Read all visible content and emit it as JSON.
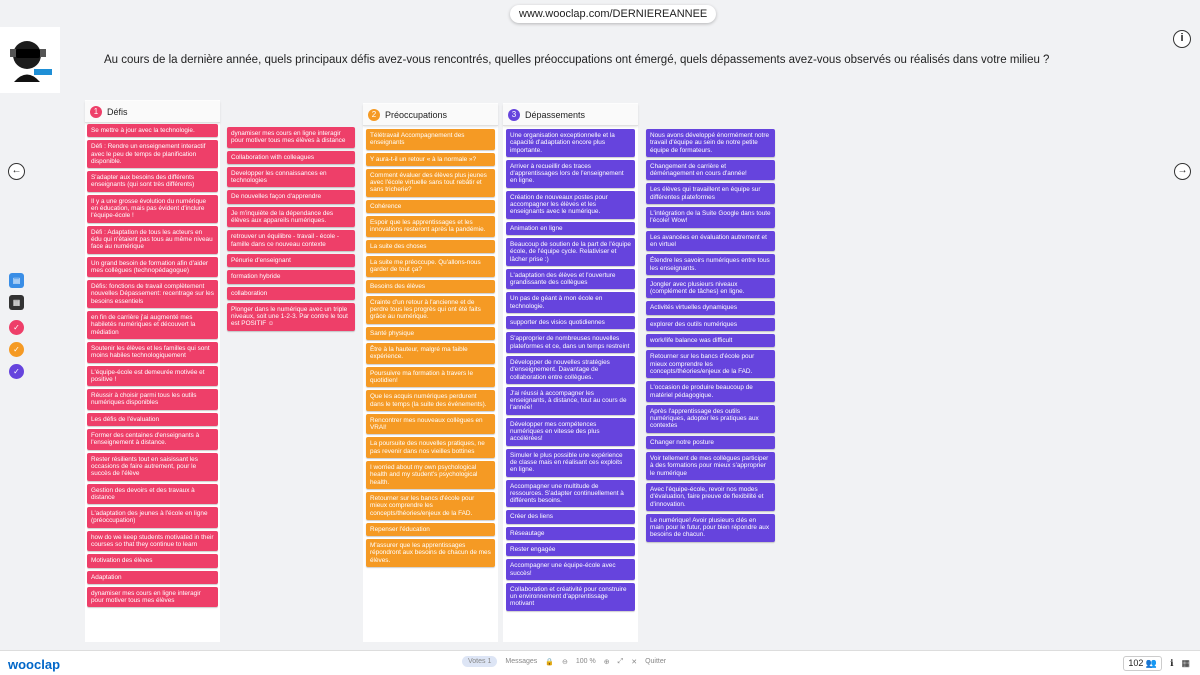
{
  "url": "www.wooclap.com/DERNIEREANNEE",
  "question": "Au cours de la dernière année, quels principaux défis avez-vous rencontrés, quelles préoccupations ont émergé, quels dépassements avez-vous observés ou réalisés dans votre milieu ?",
  "icons": {
    "info": "info-icon",
    "prev": "arrow-left-icon",
    "next": "arrow-right-icon"
  },
  "colors": {
    "pink": "#ee3f69",
    "orange": "#f59a24",
    "purple": "#6644dd",
    "brand": "#0066c8"
  },
  "columns": [
    {
      "number": "1",
      "title": "Défis",
      "color": "#ee3f69"
    },
    {
      "number": "2",
      "title": "Préoccupations",
      "color": "#f59a24"
    },
    {
      "number": "3",
      "title": "Dépassements",
      "color": "#6644dd"
    }
  ],
  "defis_col1": [
    "Se mettre à jour avec la technologie.",
    "Défi : Rendre un enseignement interactif avec le peu de temps de planification disponible.",
    "S'adapter aux besoins des différents enseignants (qui sont très différents)",
    "Il y a une grosse évolution du numérique en éducation, mais pas évident d'inclure l'équipe-école !",
    "Défi : Adaptation de tous les acteurs en édu qui n'étaient pas tous au même niveau face au numérique",
    "Un grand besoin de formation afin d'aider mes collègues (technopédagogue)",
    "Défis: fonctions de travail complètement nouvelles Dépassement: recentrage sur les besoins essentiels",
    "en fin de carrière j'ai augmenté mes habiletés numériques et découvert la médiation",
    "Soutenir les élèves et les familles qui sont moins habiles technologiquement",
    "L'équipe-école est demeurée motivée et positive !",
    "Réussir à choisir parmi tous les outils numériques disponibles",
    "Les défis de l'évaluation",
    "Former des centaines d'enseignants à l'enseignement à distance.",
    "Rester résilients tout en saisissant les occasions de faire autrement, pour le succès de l'élève",
    "Gestion des devoirs et des travaux à distance",
    "L'adaptation des jeunes à l'école en ligne (préoccupation)",
    "how do we keep students motivated in their courses so that they continue to learn",
    "Motivation des élèves",
    "Adaptation",
    "dynamiser mes cours en ligne interagir pour motiver tous mes élèves"
  ],
  "defis_col2": [
    "dynamiser mes cours en ligne interagir pour motiver tous mes élèves à distance",
    "Collaboration with colleagues",
    "Developper les connaissances en technologies",
    "De nouvelles façon d'apprendre",
    "Je m'inquiète de la dépendance des élèves aux appareils numériques.",
    "retrouver un équilibre - travail - école - famille dans ce nouveau contexte",
    "Pénurie d'enseignant",
    "formation hybride",
    "collaboration",
    "Plonger dans le numérique avec un triple niveaux, soit une 1-2-3. Par contre le tout est POSITIF ☺"
  ],
  "preoccupations": [
    "Télétravail Accompagnement des enseignants",
    "Y aura-t-il un retour « à la normale »?",
    "Comment évaluer des élèves plus jeunes avec l'école virtuelle sans tout rebâtir et sans tricherie?",
    "Cohérence",
    "Espoir que les apprentissages et les innovations resteront après la pandémie.",
    "La suite des choses",
    "La suite me préoccupe. Qu'allons-nous garder de tout ça?",
    "Besoins des élèves",
    "Crainte d'un retour à l'ancienne et de perdre tous les progrès qui ont été faits grâce au numérique.",
    "Santé physique",
    "Être à la hauteur, malgré ma faible expérience.",
    "Poursuivre ma formation à travers le quotidien!",
    "Que les acquis numériques perdurent dans le temps (la suite des événements).",
    "Rencontrer mes nouveaux collègues en VRAI!",
    "La poursuite des nouvelles pratiques, ne pas revenir dans nos vieilles bottines",
    "I worried about my own psychological health and my student's psychological health.",
    "Retourner sur les bancs d'école pour mieux comprendre les concepts/théories/enjeux de la FAD.",
    "Repenser l'éducation",
    "M'assurer que les apprentissages répondront aux besoins de chacun de mes élèves."
  ],
  "depassements_col1": [
    "Une organisation exceptionnelle et la capacité d'adaptation encore plus importante.",
    "Arriver à recueillir des traces d'apprentissages lors de l'enseignement en ligne.",
    "Création de nouveaux postes pour accompagner les élèves et les enseignants avec le numérique.",
    "Animation en ligne",
    "Beaucoup de soutien de la part de l'équipe école, de l'équipe cycle. Relativiser et lâcher prise :)",
    "L'adaptation des élèves et l'ouverture grandissante des collègues",
    "Un pas de géant à mon école en technologie.",
    "supporter des visios quotidiennes",
    "S'approprier de nombreuses nouvelles plateformes et ce, dans un temps restreint",
    "Développer de nouvelles stratégies d'enseignement. Davantage de collaboration entre collègues.",
    "J'ai réussi à accompagner les enseignants, à distance, tout au cours de l'année!",
    "Développer mes compétences numériques en vitesse des plus accélérées!",
    "Simuler le plus possible une expérience de classe mais en réalisant ces exploits en ligne.",
    "Accompagner une multitude de ressources. S'adapter continuellement à différents besoins.",
    "Créer des liens",
    "Réseautage",
    "Rester engagée",
    "Accompagner une équipe-école avec succès!",
    "Collaboration et créativité pour construire un environnement d'apprentissage motivant"
  ],
  "depassements_col2": [
    "Nous avons développé énormément notre travail d'équipe au sein de notre petite équipe de formateurs.",
    "Changement de carrière et déménagement en cours d'année!",
    "Les élèves qui travaillent en équipe sur différentes plateformes",
    "L'intégration de la Suite Google dans toute l'école! Wow!",
    "Les avancées en évaluation autrement et en virtuel",
    "Étendre les savoirs numériques entre tous les enseignants.",
    "Jongler avec plusieurs niveaux (complément de tâches) en ligne.",
    "Activités virtuelles dynamiques",
    "explorer des outils numériques",
    "work/life balance was difficult",
    "Retourner sur les bancs d'école pour mieux comprendre les concepts/théories/enjeux de la FAD.",
    "L'occasion de produire beaucoup de matériel pédagogique.",
    "Après l'apprentissage des outils numériques, adopter les pratiques aux contextes",
    "Changer notre posture",
    "Voir tellement de mes collègues participer à des formations pour mieux s'approprier le numérique",
    "Avec l'équipe-école, revoir nos modes d'évaluation, faire preuve de flexibilité et d'innovation.",
    "Le numérique! Avoir plusieurs clés en main pour le futur, pour bien répondre aux besoins de chacun."
  ],
  "bottom": {
    "brand": "wooclap",
    "votes_label": "Votes",
    "votes_num": "1",
    "messages_label": "Messages",
    "zoom": "100 %",
    "quit": "Quitter",
    "participants": "102"
  }
}
